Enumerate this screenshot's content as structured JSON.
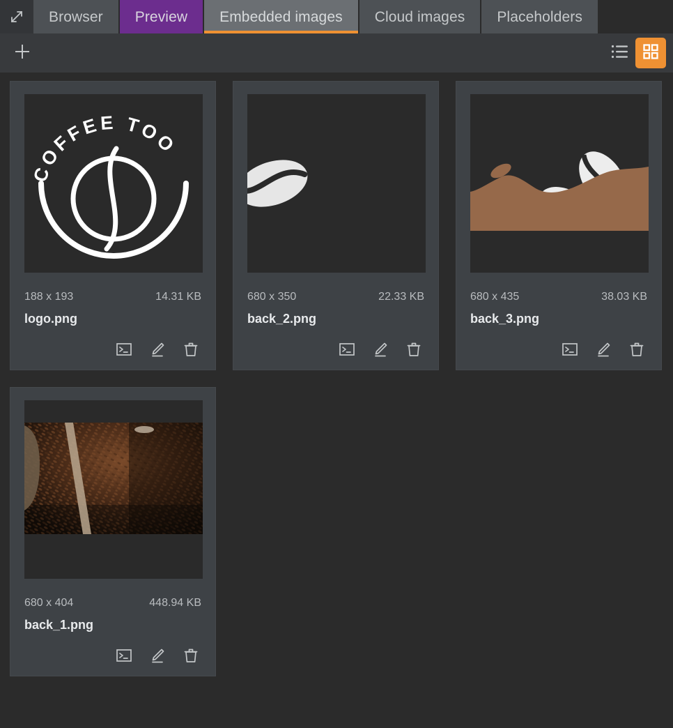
{
  "window": {
    "expand_icon": "expand-diagonal-icon",
    "background": "#2b2b2b"
  },
  "tabs": [
    {
      "label": "Browser",
      "state": "inactive",
      "style": "gray",
      "color": "#4d5155"
    },
    {
      "label": "Preview",
      "state": "inactive",
      "style": "purple",
      "color": "#6c2d8e"
    },
    {
      "label": "Embedded images",
      "state": "active",
      "style": "active",
      "color": "#6b6f73",
      "underline": "#ef9133"
    },
    {
      "label": "Cloud images",
      "state": "inactive",
      "style": "gray",
      "color": "#4d5155"
    },
    {
      "label": "Placeholders",
      "state": "inactive",
      "style": "gray",
      "color": "#4d5155"
    }
  ],
  "toolbar": {
    "add_icon": "plus-icon",
    "add_label": "Add",
    "list_view_icon": "list-view-icon",
    "list_view_label": "List view",
    "grid_view_icon": "grid-view-icon",
    "grid_view_label": "Grid view",
    "active_view": "grid",
    "accent_color": "#ef9133"
  },
  "actions": {
    "console_icon": "terminal-icon",
    "console_label": "Console",
    "edit_icon": "pencil-icon",
    "edit_label": "Edit",
    "delete_icon": "trash-icon",
    "delete_label": "Delete"
  },
  "images": [
    {
      "filename": "logo.png",
      "dimensions": "188 x 193",
      "size": "14.31 KB",
      "thumb": "logo",
      "thumb_text_outer": "COFFEE",
      "thumb_text_inner": "TOO"
    },
    {
      "filename": "back_2.png",
      "dimensions": "680 x 350",
      "size": "22.33 KB",
      "thumb": "bean-left"
    },
    {
      "filename": "back_3.png",
      "dimensions": "680 x 435",
      "size": "38.03 KB",
      "thumb": "hills-beans",
      "hill_color": "#96694a"
    },
    {
      "filename": "back_1.png",
      "dimensions": "680 x 404",
      "size": "448.94 KB",
      "thumb": "coffee-photo"
    }
  ]
}
